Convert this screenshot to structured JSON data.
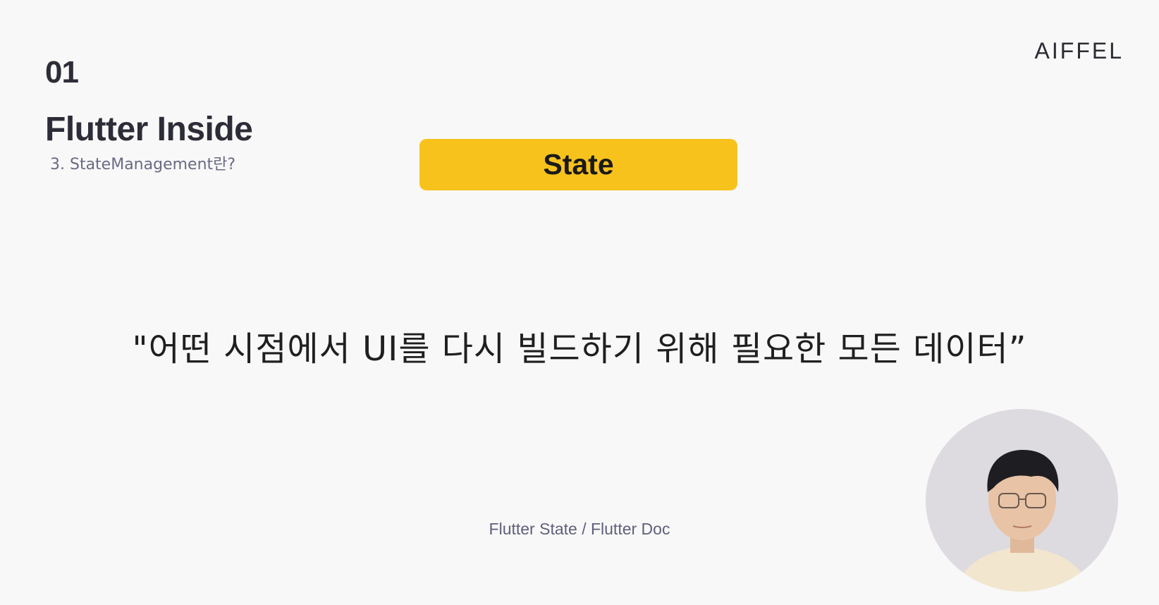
{
  "slide": {
    "number": "01",
    "title": "Flutter Inside",
    "subtitle": "3. StateManagement란?"
  },
  "brand": {
    "logo_text": "AIFFEL"
  },
  "topic": {
    "label": "State",
    "accent_color": "#f8c21d"
  },
  "quote": {
    "text": "\"어떤 시점에서 UI를 다시 빌드하기 위해 필요한 모든 데이터”"
  },
  "source": {
    "text": "Flutter State / Flutter Doc"
  },
  "presenter": {
    "icon": "presenter-webcam"
  }
}
